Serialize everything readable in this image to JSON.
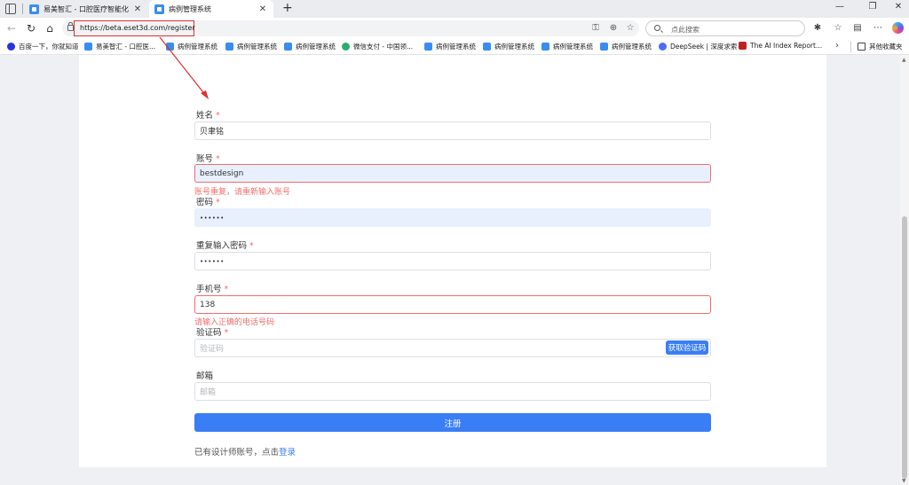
{
  "browser": {
    "tabs": [
      {
        "title": "易美智汇 - 口腔医疗智能化",
        "active": false
      },
      {
        "title": "病例管理系统",
        "active": true
      }
    ],
    "url": "https://beta.eset3d.com/register",
    "search_placeholder": "点此搜索",
    "bookmarks": [
      {
        "label": "百度一下，你就知道",
        "icon": "baidu-icon"
      },
      {
        "label": "易美智汇 - 口腔医...",
        "icon": "site-icon"
      },
      {
        "label": "病例管理系统",
        "icon": "site-icon"
      },
      {
        "label": "病例管理系统",
        "icon": "site-icon"
      },
      {
        "label": "病例管理系统",
        "icon": "site-icon"
      },
      {
        "label": "微信支付 - 中国领...",
        "icon": "wechat-icon"
      },
      {
        "label": "病例管理系统",
        "icon": "site-icon"
      },
      {
        "label": "病例管理系统",
        "icon": "site-icon"
      },
      {
        "label": "病例管理系统",
        "icon": "site-icon"
      },
      {
        "label": "病例管理系统",
        "icon": "site-icon"
      },
      {
        "label": "DeepSeek | 深度求索",
        "icon": "deepseek-icon"
      },
      {
        "label": "The AI Index Report...",
        "icon": "ai-index-icon"
      }
    ],
    "other_bookmarks": "其他收藏夹"
  },
  "form": {
    "name": {
      "label": "姓名",
      "value": "贝聿铭"
    },
    "account": {
      "label": "账号",
      "value": "bestdesign",
      "error": "账号重复，请重新输入账号"
    },
    "password": {
      "label": "密码",
      "value": "••••••"
    },
    "confirm_password": {
      "label": "重复输入密码",
      "value": "••••••"
    },
    "phone": {
      "label": "手机号",
      "value": "138",
      "error": "请输入正确的电话号码"
    },
    "code": {
      "label": "验证码",
      "placeholder": "验证码",
      "button": "获取验证码"
    },
    "email": {
      "label": "邮箱",
      "placeholder": "邮箱"
    },
    "required_mark": "*",
    "submit": "注册",
    "login_prompt": "已有设计师账号，点击",
    "login_link": "登录"
  },
  "colors": {
    "primary": "#3a7ef5",
    "error": "#f56c6c",
    "annotation": "#e03030"
  }
}
